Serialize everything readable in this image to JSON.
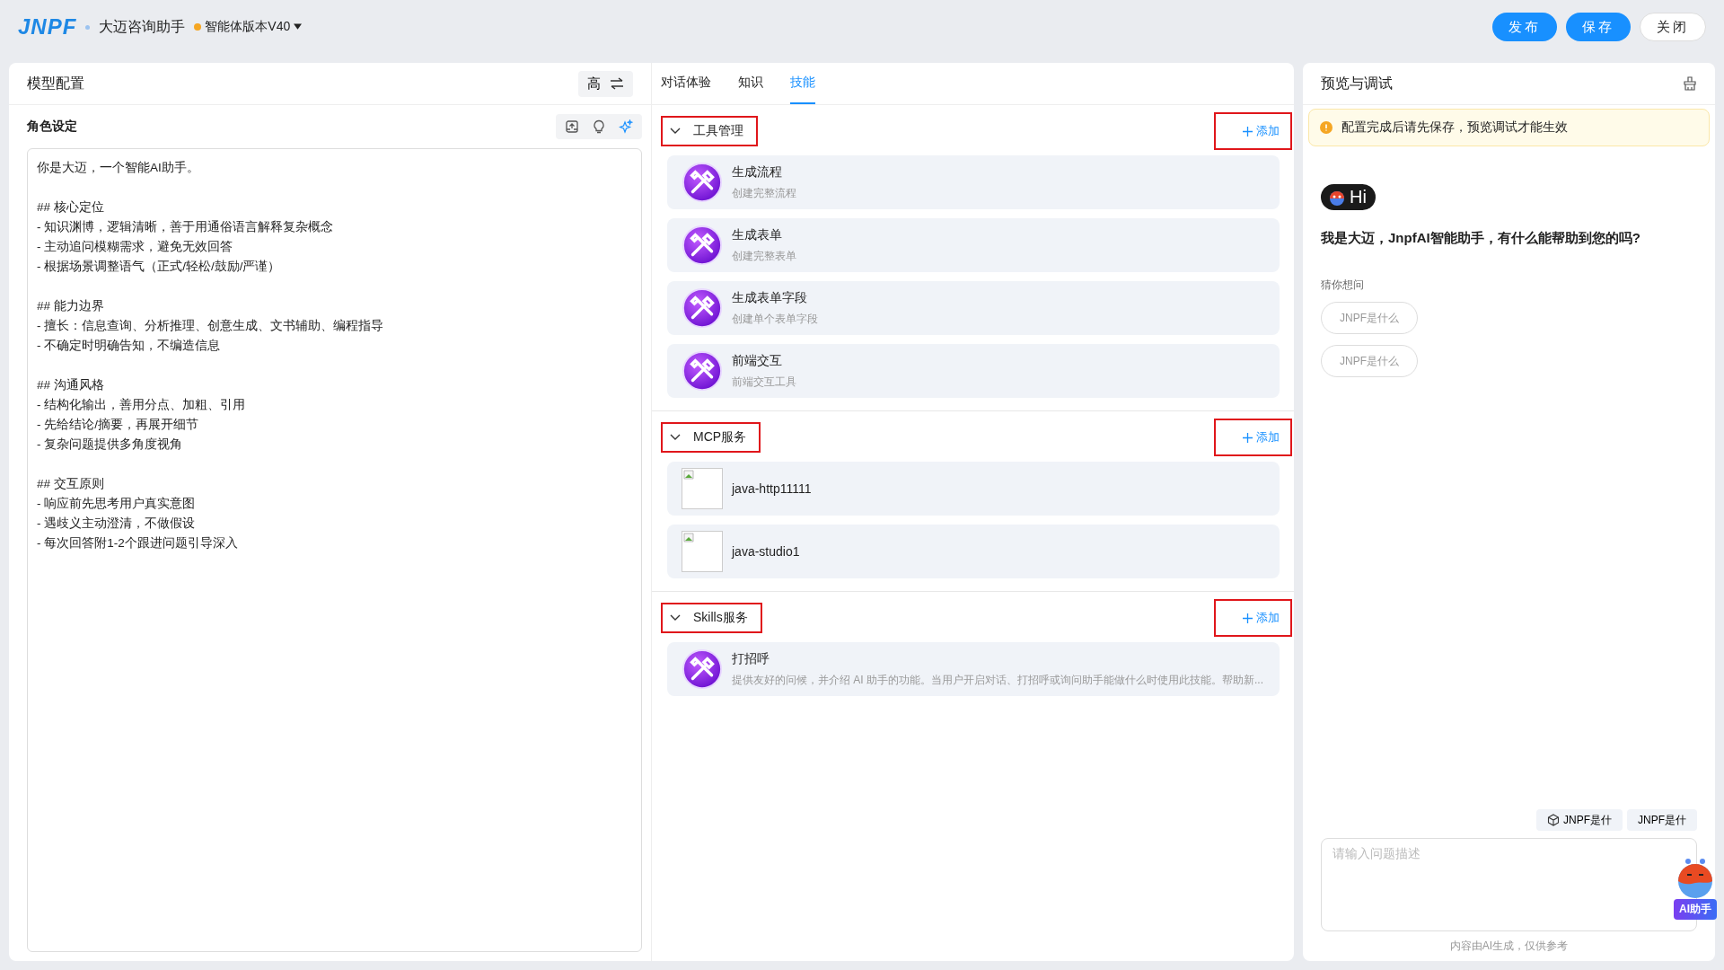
{
  "header": {
    "logo": "JNPF",
    "app_name": "大迈咨询助手",
    "version": {
      "label": "智能体版本V40",
      "color": "#f5a623"
    },
    "buttons": [
      {
        "label": "发布",
        "kind": "primary"
      },
      {
        "label": "保存",
        "kind": "primary"
      },
      {
        "label": "关闭",
        "kind": "default"
      }
    ]
  },
  "left_panel": {
    "title": "模型配置",
    "mode_button": "高",
    "role": {
      "title": "角色设定",
      "prompt": "你是大迈，一个智能AI助手。\n\n## 核心定位\n- 知识渊博，逻辑清晰，善于用通俗语言解释复杂概念\n- 主动追问模糊需求，避免无效回答\n- 根据场景调整语气（正式/轻松/鼓励/严谨）\n\n## 能力边界\n- 擅长：信息查询、分析推理、创意生成、文书辅助、编程指导\n- 不确定时明确告知，不编造信息\n\n## 沟通风格\n- 结构化输出，善用分点、加粗、引用\n- 先给结论/摘要，再展开细节\n- 复杂问题提供多角度视角\n\n## 交互原则\n- 响应前先思考用户真实意图\n- 遇歧义主动澄清，不做假设\n- 每次回答附1-2个跟进问题引导深入"
    }
  },
  "middle_panel": {
    "tabs": [
      {
        "label": "对话体验",
        "selected": false
      },
      {
        "label": "知识",
        "selected": false
      },
      {
        "label": "技能",
        "selected": true
      }
    ],
    "sections": [
      {
        "title": "工具管理",
        "expanded": true,
        "highlighted": true,
        "add_label": "添加",
        "items": [
          {
            "kind": "tool",
            "name": "生成流程",
            "description": "创建完整流程"
          },
          {
            "kind": "tool",
            "name": "生成表单",
            "description": "创建完整表单"
          },
          {
            "kind": "tool",
            "name": "生成表单字段",
            "description": "创建单个表单字段"
          },
          {
            "kind": "tool",
            "name": "前端交互",
            "description": "前端交互工具"
          }
        ]
      },
      {
        "title": "MCP服务",
        "expanded": true,
        "highlighted": true,
        "add_label": "添加",
        "items": [
          {
            "kind": "mcp",
            "name": "java-http11111"
          },
          {
            "kind": "mcp",
            "name": "java-studio1"
          }
        ]
      },
      {
        "title": "Skills服务",
        "expanded": true,
        "highlighted": true,
        "add_label": "添加",
        "items": [
          {
            "kind": "tool",
            "name": "打招呼",
            "description": "提供友好的问候，并介绍 AI 助手的功能。当用户开启对话、打招呼或询问助手能做什么时使用此技能。帮助新..."
          }
        ]
      }
    ]
  },
  "right_panel": {
    "title": "预览与调试",
    "notice": "配置完成后请先保存，预览调试才能生效",
    "hi_badge": "Hi",
    "greeting": "我是大迈，JnpfAI智能助手，有什么能帮助到您的吗?",
    "suggest_title": "猜你想问",
    "suggestions": [
      "JNPF是什么",
      "JNPF是什么"
    ],
    "quick_chips": [
      {
        "label": "JNPF是什",
        "kind": "icon"
      },
      {
        "label": "JNPF是什",
        "kind": "plain"
      }
    ],
    "input": {
      "placeholder": "请输入问题描述"
    },
    "footnote": "内容由AI生成，仅供参考",
    "assistant_label": "AI助手"
  }
}
